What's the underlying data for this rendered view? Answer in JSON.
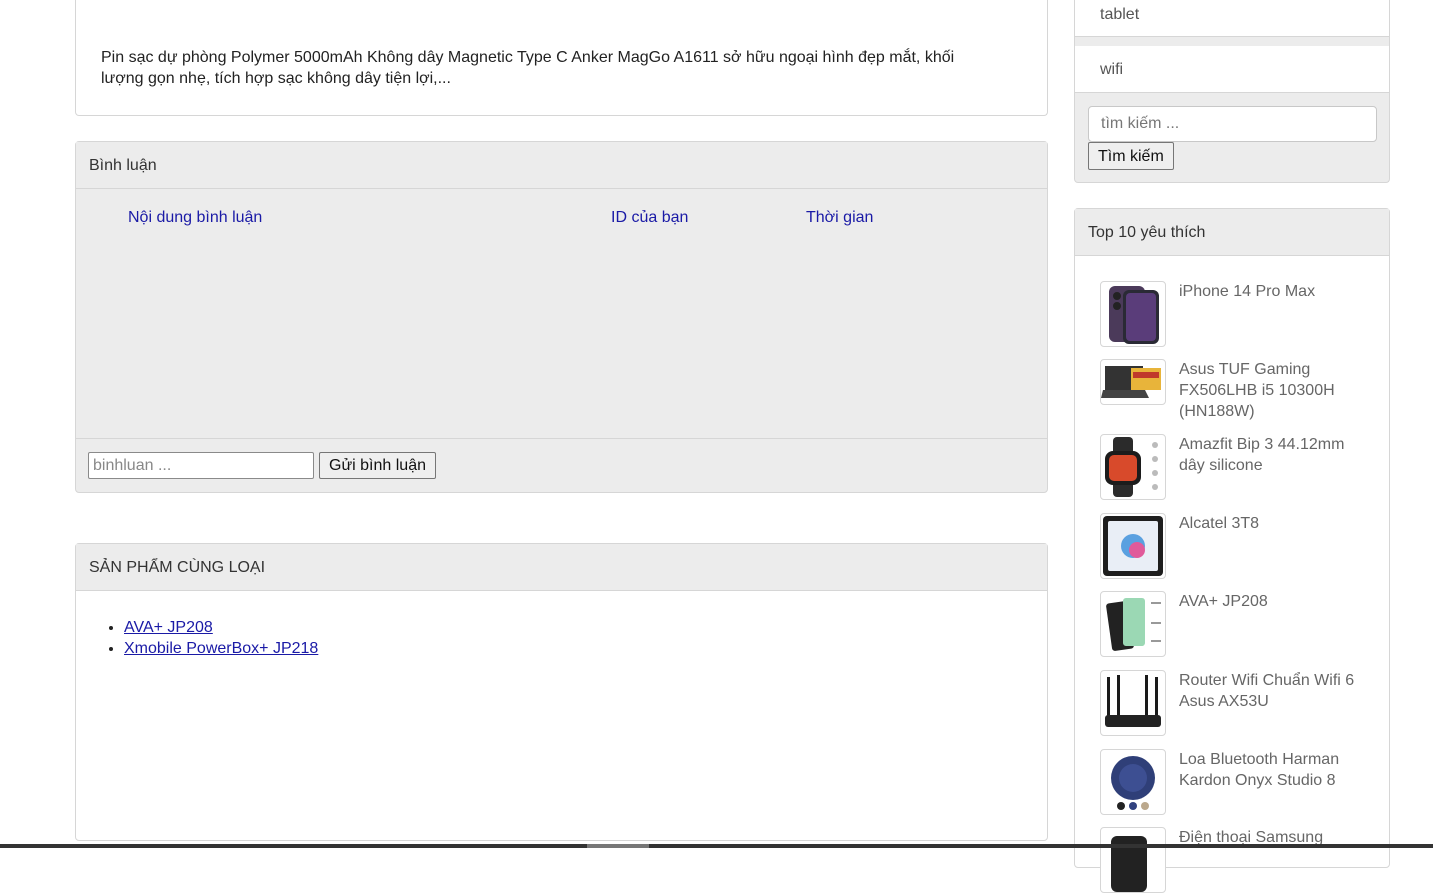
{
  "description": {
    "text": "Pin sạc dự phòng Polymer 5000mAh Không dây Magnetic Type C Anker MagGo A1611 sở hữu ngoại hình đẹp mắt, khối lượng gọn nhẹ, tích hợp sạc không dây tiện lợi,..."
  },
  "comments": {
    "title": "Bình luận",
    "col_content": "Nội dung bình luận",
    "col_id": "ID của bạn",
    "col_time": "Thời gian",
    "input_placeholder": "binhluan ...",
    "submit_label": "Gửi bình luận"
  },
  "related": {
    "title": "SẢN PHẨM CÙNG LOẠI",
    "items": [
      "AVA+ JP208",
      "Xmobile PowerBox+ JP218"
    ]
  },
  "sidebar": {
    "categories": [
      "tablet",
      "wifi"
    ],
    "search_placeholder": "tìm kiếm ...",
    "search_button": "Tìm kiếm",
    "top_title": "Top 10 yêu thích",
    "top_items": [
      {
        "name": "iPhone 14 Pro Max",
        "icon": "phone-thumbnail"
      },
      {
        "name": "Asus TUF Gaming FX506LHB i5 10300H (HN188W)",
        "icon": "laptop-thumbnail"
      },
      {
        "name": "Amazfit Bip 3 44.12mm dây silicone",
        "icon": "smartwatch-thumbnail"
      },
      {
        "name": "Alcatel 3T8",
        "icon": "tablet-thumbnail"
      },
      {
        "name": "AVA+ JP208",
        "icon": "powerbank-thumbnail"
      },
      {
        "name": "Router Wifi Chuẩn Wifi 6 Asus AX53U",
        "icon": "router-thumbnail"
      },
      {
        "name": "Loa Bluetooth Harman Kardon Onyx Studio 8",
        "icon": "speaker-thumbnail"
      },
      {
        "name": "Điện thoại Samsung",
        "icon": "phone-thumbnail"
      }
    ]
  }
}
